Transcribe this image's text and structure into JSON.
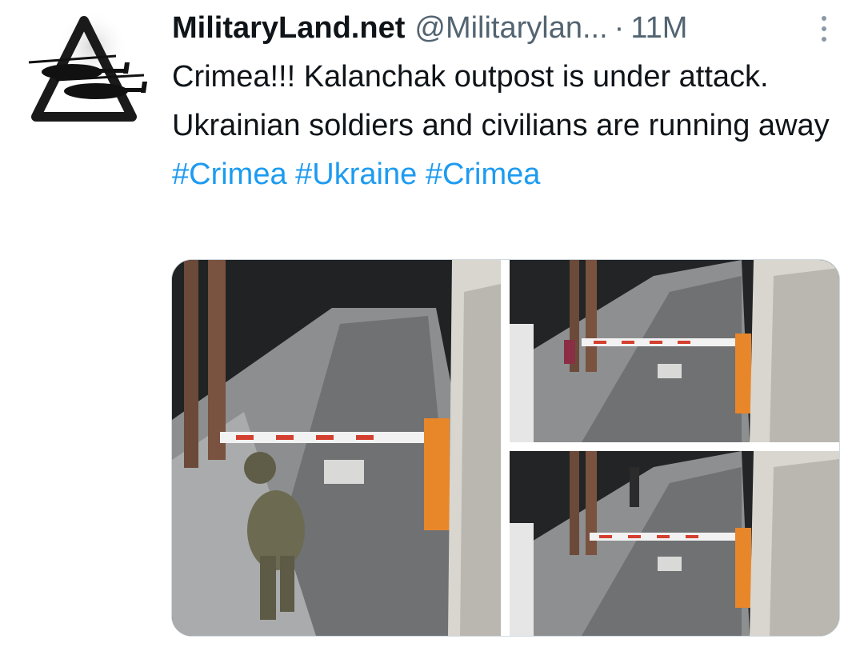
{
  "tweet": {
    "author": {
      "display_name": "MilitaryLand.net",
      "handle": "@Militarylan...",
      "avatar_icon": "triangle-helicopter-logo"
    },
    "separator": "·",
    "timestamp": "11M",
    "more_icon": "vertical-ellipsis-icon",
    "text_plain": "Crimea!!! Kalanchak outpost is under attack. Ukrainian soldiers and civilians are running away",
    "hashtags": [
      "#Crimea",
      "#Ukraine",
      "#Crimea"
    ],
    "colors": {
      "hashtag": "#1d9bf0",
      "text": "#0f1419",
      "secondary": "#536471",
      "barrier_orange": "#e8862a"
    }
  }
}
